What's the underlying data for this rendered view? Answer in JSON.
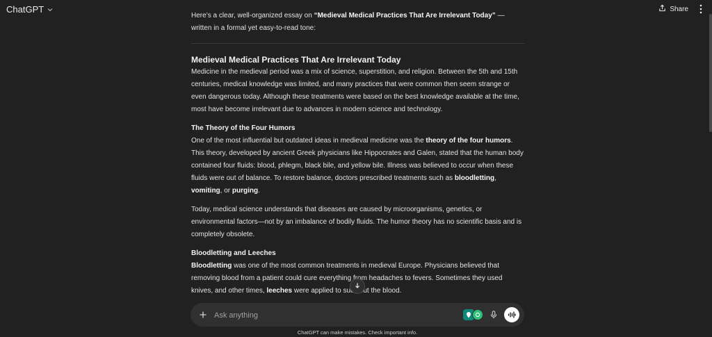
{
  "header": {
    "model_name": "ChatGPT",
    "share_label": "Share"
  },
  "message": {
    "intro_prefix": "Here’s a clear, well-organized essay on ",
    "intro_topic": "“Medieval Medical Practices That Are Irrelevant Today”",
    "intro_suffix": " — written in a formal yet easy-to-read tone:",
    "title": "Medieval Medical Practices That Are Irrelevant Today",
    "paragraph1": "Medicine in the medieval period was a mix of science, superstition, and religion. Between the 5th and 15th centuries, medical knowledge was limited, and many practices that were common then seem strange or even dangerous today. Although these treatments were based on the best knowledge available at the time, most have become irrelevant due to advances in modern science and technology.",
    "section1": {
      "heading": "The Theory of the Four Humors",
      "p1_a": "One of the most influential but outdated ideas in medieval medicine was the ",
      "p1_b": "theory of the four humors",
      "p1_c": ". This theory, developed by ancient Greek physicians like Hippocrates and Galen, stated that the human body contained four fluids: blood, phlegm, black bile, and yellow bile. Illness was believed to occur when these fluids were out of balance. To restore balance, doctors prescribed treatments such as ",
      "p1_d": "bloodletting",
      "p1_e": ", ",
      "p1_f": "vomiting",
      "p1_g": ", or ",
      "p1_h": "purging",
      "p1_i": ".",
      "p2": "Today, medical science understands that diseases are caused by microorganisms, genetics, or environmental factors—not by an imbalance of bodily fluids. The humor theory has no scientific basis and is completely obsolete."
    },
    "section2": {
      "heading": "Bloodletting and Leeches",
      "p1_a": "Bloodletting",
      "p1_b": " was one of the most common treatments in medieval Europe. Physicians believed that removing blood from a patient could cure everything from headaches to fevers. Sometimes they used knives, and other times, ",
      "p1_c": "leeches",
      "p1_d": " were applied to suck out the blood."
    }
  },
  "composer": {
    "placeholder": "Ask anything"
  },
  "footer": {
    "disclaimer": "ChatGPT can make mistakes. Check important info."
  },
  "icons": {
    "model_chevron": "chevron-down-icon",
    "share": "share-icon",
    "more": "more-icon",
    "scroll": "arrow-down-icon",
    "plus": "plus-icon",
    "mic": "mic-icon",
    "voice": "voice-mode-icon"
  }
}
